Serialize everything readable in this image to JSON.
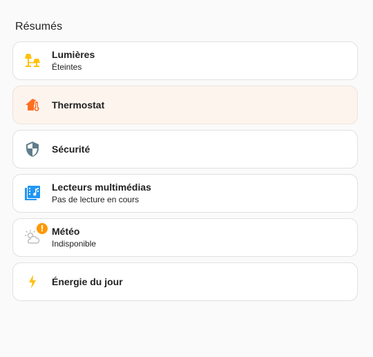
{
  "section": {
    "title": "Résumés"
  },
  "cards": [
    {
      "title": "Lumières",
      "subtitle": "Éteintes",
      "icon": "lamps-icon",
      "color": "#ffc107"
    },
    {
      "title": "Thermostat",
      "subtitle": "",
      "icon": "home-thermometer-icon",
      "color": "#ff6f22"
    },
    {
      "title": "Sécurité",
      "subtitle": "",
      "icon": "shield-icon",
      "color": "#607d8b"
    },
    {
      "title": "Lecteurs multimédias",
      "subtitle": "Pas de lecture en cours",
      "icon": "media-library-icon",
      "color": "#2196f3"
    },
    {
      "title": "Météo",
      "subtitle": "Indisponible",
      "icon": "weather-partly-cloudy-icon",
      "color": "#9e9e9e",
      "badge": "!",
      "badge_color": "#ff9800"
    },
    {
      "title": "Énergie du jour",
      "subtitle": "",
      "icon": "lightning-bolt-icon",
      "color": "#ffc107"
    }
  ]
}
